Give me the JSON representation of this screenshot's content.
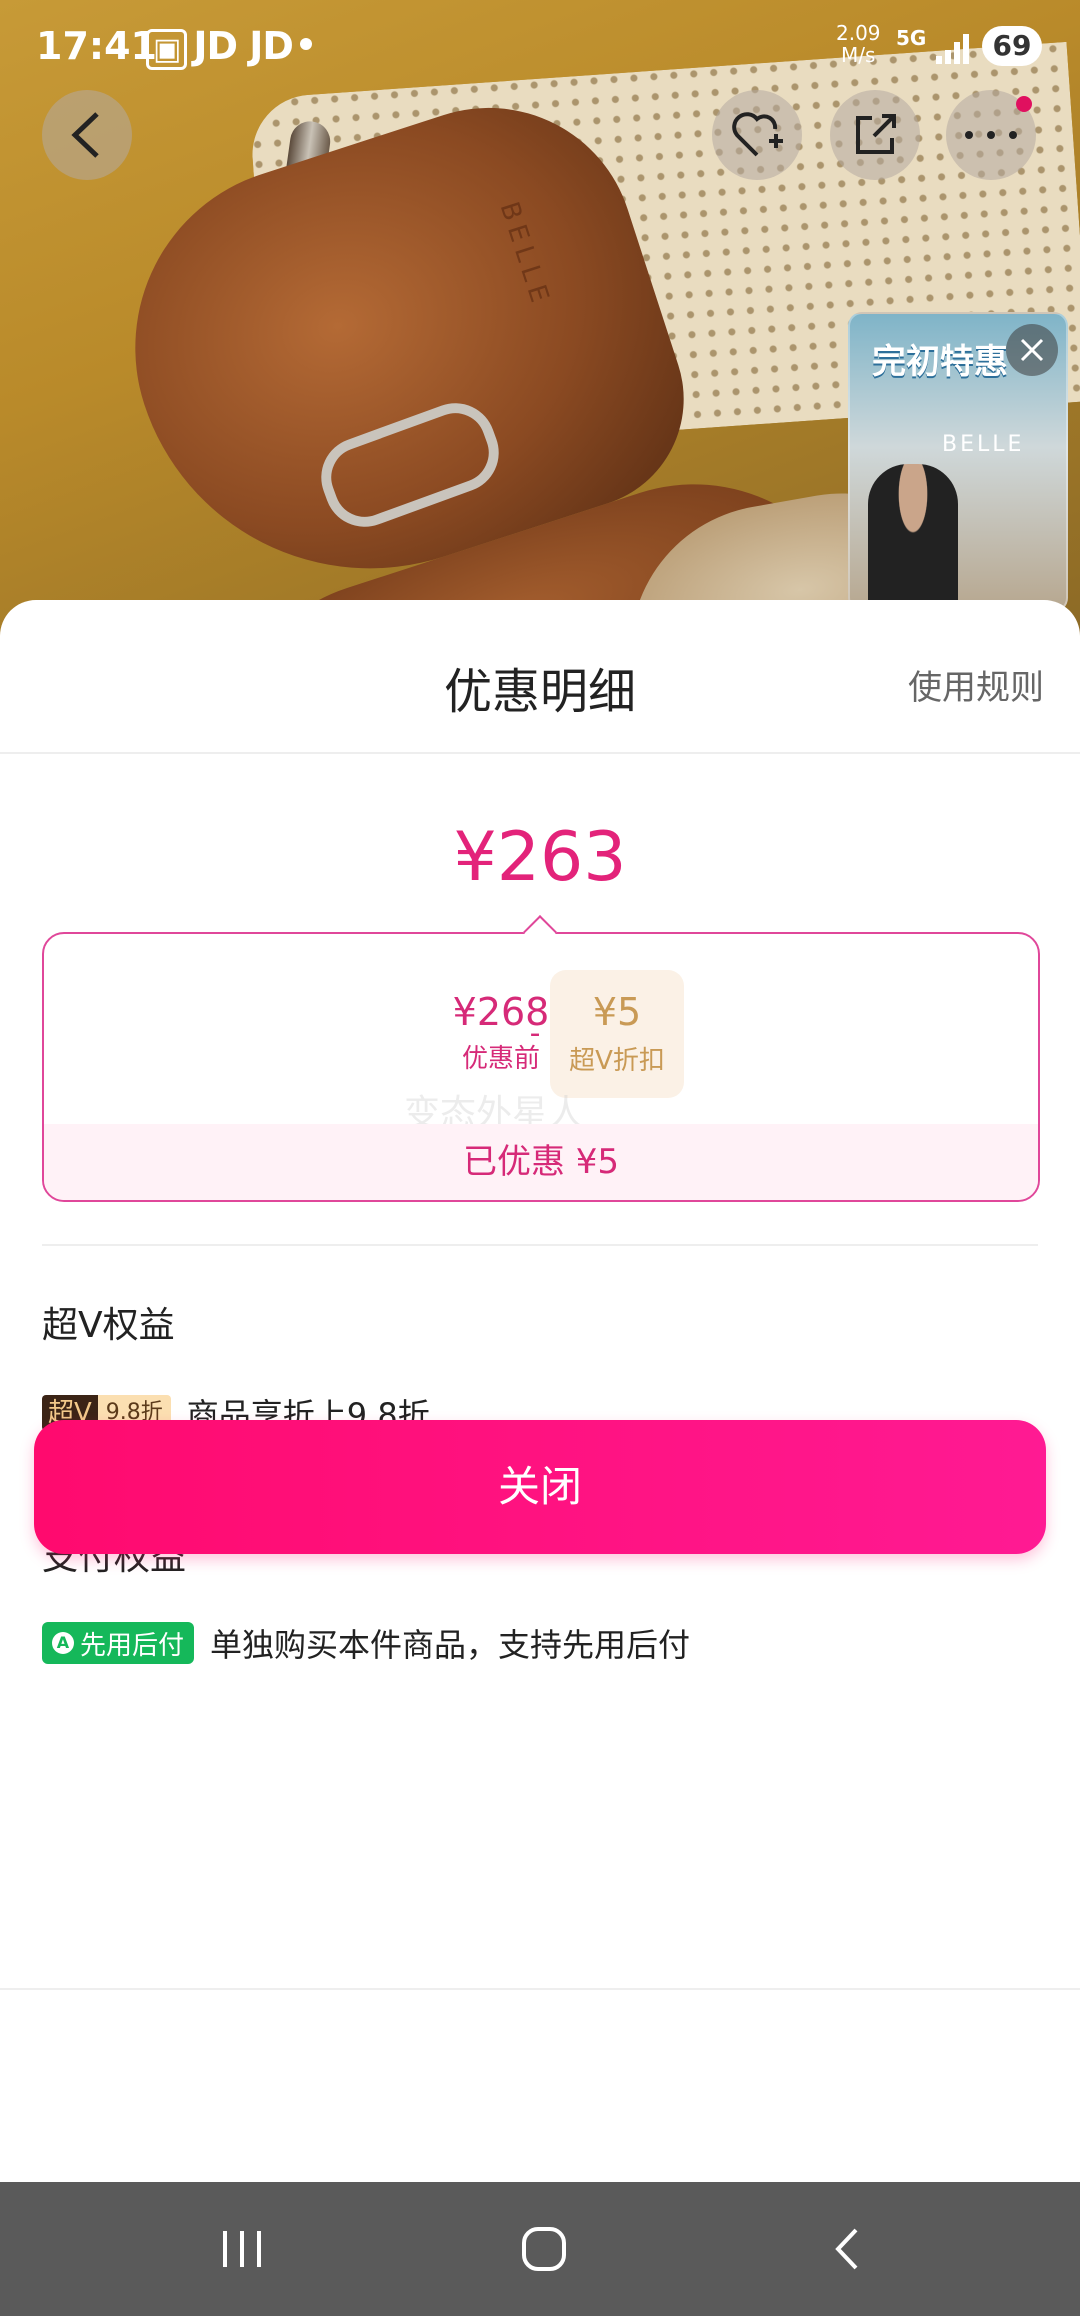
{
  "status_bar": {
    "time": "17:41",
    "carrier": "JD JD",
    "speed_value": "2.09",
    "speed_unit": "M/s",
    "network": "5G",
    "battery": "69"
  },
  "hero": {
    "brand_emboss": "BELLE",
    "live_banner": "完初特惠",
    "live_brand": "BELLE"
  },
  "sheet": {
    "title": "优惠明细",
    "rules_link": "使用规则",
    "final_price": "¥263",
    "original_price": "¥268",
    "original_label": "优惠前",
    "minus": "-",
    "discount_value": "¥5",
    "discount_label": "超V折扣",
    "watermark": "变态外星人",
    "saved_text": "已优惠 ¥5"
  },
  "svip_section": {
    "title": "超V权益",
    "badge_a": "超V",
    "badge_b": "9.8折",
    "text": "商品享折上9.8折"
  },
  "pay_section": {
    "title": "支付权益",
    "badge": "先用后付",
    "text": "单独购买本件商品，支持先用后付"
  },
  "close_button": "关闭",
  "colors": {
    "accent": "#e3237a",
    "button_pink": "#ff0a6e",
    "pay_green": "#15b85a"
  }
}
